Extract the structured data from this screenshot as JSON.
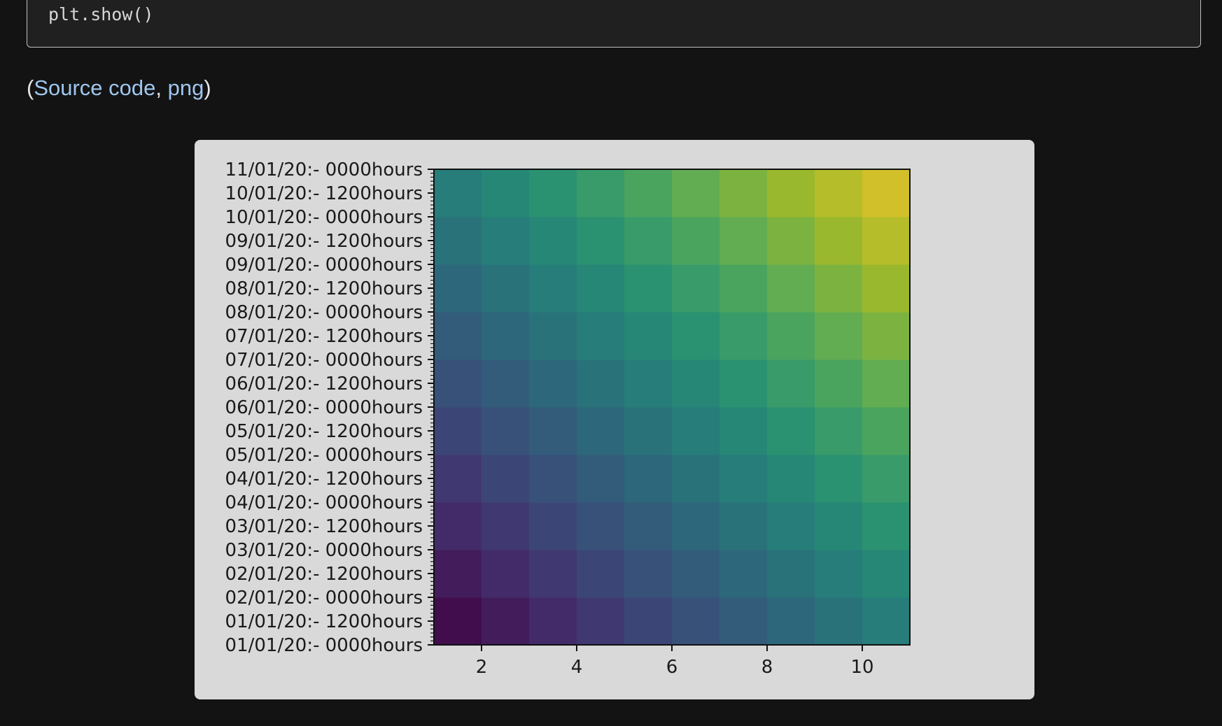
{
  "code": {
    "line": "plt.show()"
  },
  "source_links": {
    "open_paren": "(",
    "source_code": "Source code",
    "separator": ", ",
    "png": "png",
    "close_paren": ")"
  },
  "chart_data": {
    "type": "heatmap",
    "title": "",
    "xlabel": "",
    "ylabel": "",
    "colormap": "viridis",
    "x_ticks": [
      2,
      4,
      6,
      8,
      10
    ],
    "xlim": [
      1,
      11
    ],
    "y_tick_labels": [
      "01/01/20:- 0000hours",
      "01/01/20:- 1200hours",
      "02/01/20:- 0000hours",
      "02/01/20:- 1200hours",
      "03/01/20:- 0000hours",
      "03/01/20:- 1200hours",
      "04/01/20:- 0000hours",
      "04/01/20:- 1200hours",
      "05/01/20:- 0000hours",
      "05/01/20:- 1200hours",
      "06/01/20:- 0000hours",
      "06/01/20:- 1200hours",
      "07/01/20:- 0000hours",
      "07/01/20:- 1200hours",
      "08/01/20:- 0000hours",
      "08/01/20:- 1200hours",
      "09/01/20:- 0000hours",
      "09/01/20:- 1200hours",
      "10/01/20:- 0000hours",
      "10/01/20:- 1200hours",
      "11/01/20:- 0000hours"
    ],
    "grid": {
      "columns": 10,
      "rows": 10
    },
    "value_range": [
      0,
      18
    ],
    "values_note_rows_bottom_to_top": [
      [
        0,
        1,
        2,
        3,
        4,
        5,
        6,
        7,
        8,
        9
      ],
      [
        1,
        2,
        3,
        4,
        5,
        6,
        7,
        8,
        9,
        10
      ],
      [
        2,
        3,
        4,
        5,
        6,
        7,
        8,
        9,
        10,
        11
      ],
      [
        3,
        4,
        5,
        6,
        7,
        8,
        9,
        10,
        11,
        12
      ],
      [
        4,
        5,
        6,
        7,
        8,
        9,
        10,
        11,
        12,
        13
      ],
      [
        5,
        6,
        7,
        8,
        9,
        10,
        11,
        12,
        13,
        14
      ],
      [
        6,
        7,
        8,
        9,
        10,
        11,
        12,
        13,
        14,
        15
      ],
      [
        7,
        8,
        9,
        10,
        11,
        12,
        13,
        14,
        15,
        16
      ],
      [
        8,
        9,
        10,
        11,
        12,
        13,
        14,
        15,
        16,
        17
      ],
      [
        9,
        10,
        11,
        12,
        13,
        14,
        15,
        16,
        17,
        18
      ]
    ]
  }
}
